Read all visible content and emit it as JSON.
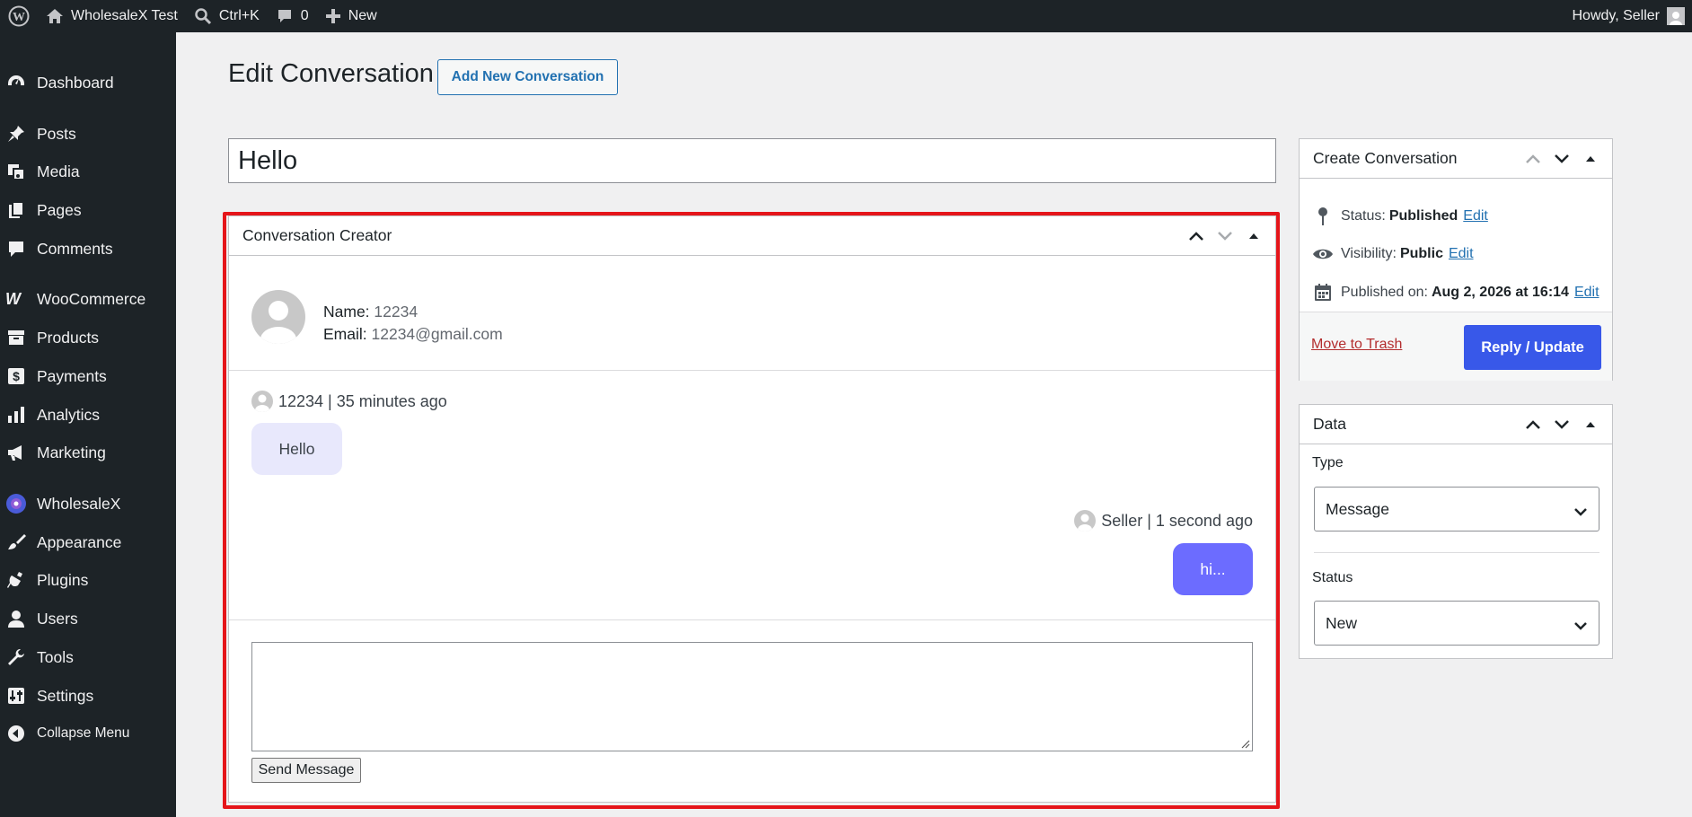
{
  "adminbar": {
    "site_name": "WholesaleX Test",
    "search_shortcut": "Ctrl+K",
    "comments_count": "0",
    "new_label": "New",
    "howdy": "Howdy, Seller"
  },
  "sidebar": {
    "items": [
      {
        "label": "Dashboard",
        "icon": "dashboard-icon"
      },
      {
        "label": "Posts",
        "icon": "pushpin-icon"
      },
      {
        "label": "Media",
        "icon": "media-icon"
      },
      {
        "label": "Pages",
        "icon": "pages-icon"
      },
      {
        "label": "Comments",
        "icon": "comment-bubble-icon"
      },
      {
        "label": "WooCommerce",
        "icon": "woocommerce-icon"
      },
      {
        "label": "Products",
        "icon": "archive-box-icon"
      },
      {
        "label": "Payments",
        "icon": "dollar-icon"
      },
      {
        "label": "Analytics",
        "icon": "bar-chart-icon"
      },
      {
        "label": "Marketing",
        "icon": "megaphone-icon"
      },
      {
        "label": "WholesaleX",
        "icon": "wholesalex-logo-icon"
      },
      {
        "label": "Appearance",
        "icon": "paintbrush-icon"
      },
      {
        "label": "Plugins",
        "icon": "plug-icon"
      },
      {
        "label": "Users",
        "icon": "user-icon"
      },
      {
        "label": "Tools",
        "icon": "wrench-icon"
      },
      {
        "label": "Settings",
        "icon": "settings-sliders-icon"
      },
      {
        "label": "Collapse Menu",
        "icon": "collapse-arrow-icon"
      }
    ]
  },
  "main": {
    "page_title": "Edit Conversation",
    "add_new_label": "Add New Conversation",
    "post_title": "Hello"
  },
  "conversation": {
    "box_title": "Conversation Creator",
    "name_label": "Name:",
    "name_value": "12234",
    "email_label": "Email:",
    "email_value": "12234@gmail.com",
    "messages": [
      {
        "meta": "12234 | 35 minutes ago",
        "text": "Hello",
        "direction": "incoming"
      },
      {
        "meta": "Seller | 1 second ago",
        "text": "hi...",
        "direction": "outgoing"
      }
    ],
    "reply_value": "",
    "send_label": "Send Message"
  },
  "publish": {
    "box_title": "Create Conversation",
    "status_label": "Status:",
    "status_value": "Published",
    "visibility_label": "Visibility:",
    "visibility_value": "Public",
    "published_label": "Published on:",
    "published_value": "Aug 2, 2026 at 16:14",
    "edit_label": "Edit",
    "trash_label": "Move to Trash",
    "update_label": "Reply / Update"
  },
  "data_box": {
    "box_title": "Data",
    "type_label": "Type",
    "type_value": "Message",
    "status_label": "Status",
    "status_value": "New"
  },
  "colors": {
    "highlight": "#e5151a",
    "primary_button": "#3858e9",
    "outgoing_bubble": "#6c6cff",
    "incoming_bubble": "#e8e8fc"
  }
}
